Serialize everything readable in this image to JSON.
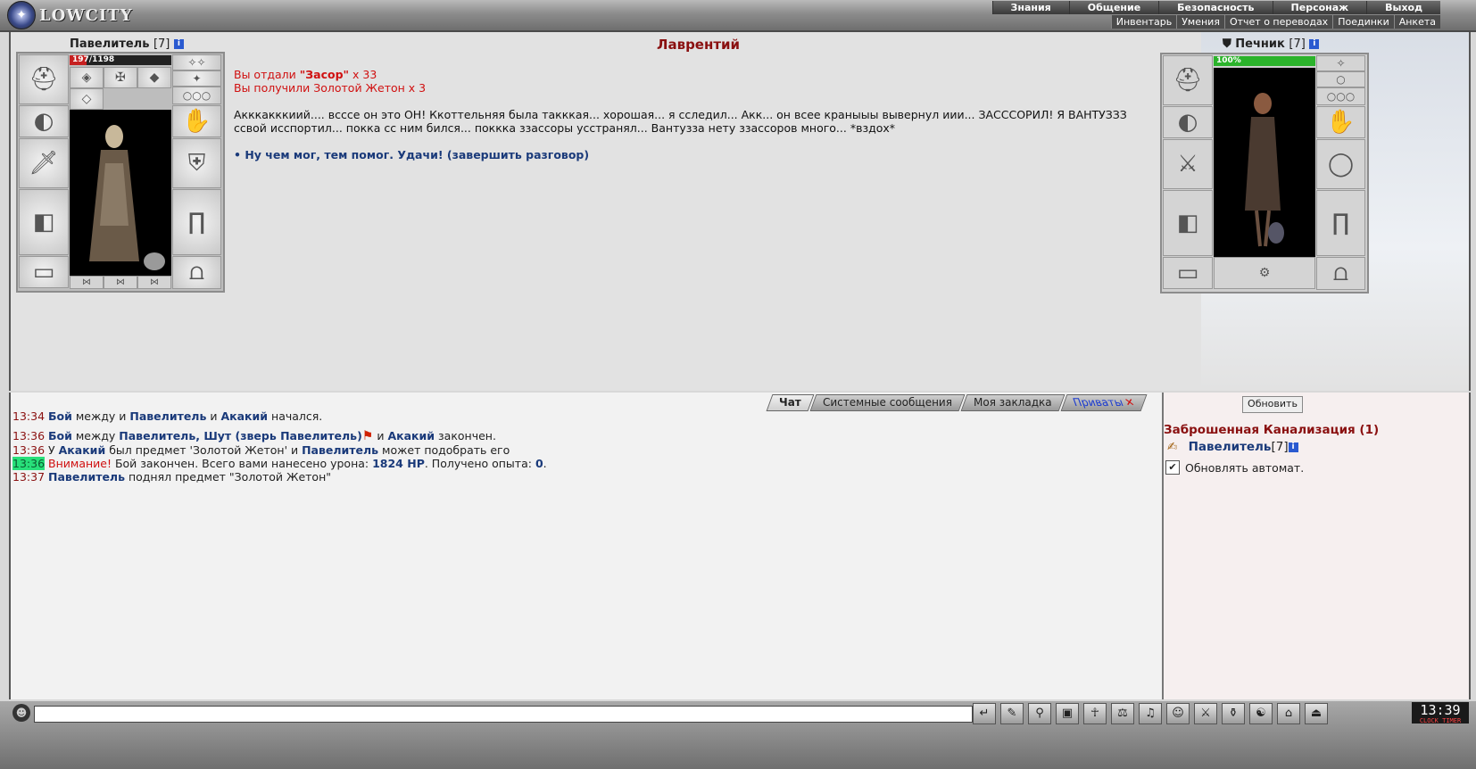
{
  "header": {
    "logo_text": "LOWCITY",
    "menu_top": [
      "Знания",
      "Общение",
      "Безопасность",
      "Персонаж",
      "Выход"
    ],
    "menu_sub": [
      "Инвентарь",
      "Умения",
      "Отчет о переводах",
      "Поединки",
      "Анкета"
    ]
  },
  "player": {
    "name": "Павелитель",
    "level": "[7]",
    "info": "i",
    "hp": "197",
    "hp_max": "/1198",
    "hp_fraction": 0.164
  },
  "npc": {
    "name": "Печник",
    "level": "[7]",
    "info": "i",
    "hp": "100%",
    "hp_fraction": 1.0
  },
  "dialog": {
    "title": "Лаврентий",
    "gave_prefix": "Вы отдали ",
    "gave_item": "\"Засор\"",
    "gave_suffix": " x 33",
    "received": "Вы получили Золотой Жетон x 3",
    "message": "Акккакккиий.... всссе он это ОН! Ккоттельняя была такккая... хорошая... я сследил... Акк... он всее краныыы вывернул иии... ЗАСССОРИЛ! Я ВАНТУЗЗЗ ссвой исспортил... покка сс ним бился... поккка ззассоры усстранял... Вантузза нету ззассоров много... *вздох*",
    "option": "• Ну чем мог, тем помог. Удачи! (завершить разговор)"
  },
  "chat": {
    "tabs": [
      "Чат",
      "Системные сообщения",
      "Моя закладка",
      "Приваты"
    ],
    "close": "✕",
    "lines": [
      {
        "time": "13:34",
        "parts": [
          [
            "b",
            "Бой"
          ],
          [
            "n",
            " между "
          ],
          [
            "n",
            "и "
          ],
          [
            "b",
            "Павелитель"
          ],
          [
            "n",
            " и "
          ],
          [
            "b",
            "Акакий"
          ],
          [
            "n",
            " начался."
          ]
        ]
      },
      {
        "time": "13:36",
        "parts": [
          [
            "b",
            "Бой"
          ],
          [
            "n",
            " между "
          ],
          [
            "b",
            "Павелитель, Шут (зверь Павелитель)"
          ],
          [
            "f",
            "⚑"
          ],
          [
            "n",
            " и "
          ],
          [
            "b",
            "Акакий"
          ],
          [
            "n",
            " закончен."
          ]
        ]
      },
      {
        "time": "13:36",
        "parts": [
          [
            "n",
            "У "
          ],
          [
            "b",
            "Акакий"
          ],
          [
            "n",
            " был предмет 'Золотой Жетон' и "
          ],
          [
            "b",
            "Павелитель"
          ],
          [
            "n",
            " может подобрать его"
          ]
        ]
      },
      {
        "time": "13:36",
        "hl": true,
        "parts": [
          [
            "w",
            "Внимание!"
          ],
          [
            "n",
            " Бой закончен. Всего вами нанесено урона: "
          ],
          [
            "b",
            "1824 HP"
          ],
          [
            "n",
            ". Получено опыта: "
          ],
          [
            "b",
            "0"
          ],
          [
            "n",
            "."
          ]
        ]
      },
      {
        "time": "13:37",
        "parts": [
          [
            "b",
            "Павелитель"
          ],
          [
            "n",
            " поднял предмет \"Золотой Жетон\""
          ]
        ]
      }
    ]
  },
  "side": {
    "refresh": "Обновить",
    "location": "Заброшенная Канализация (1)",
    "user": "Павелитель",
    "user_level": "[7]",
    "user_info": "i",
    "auto_label": "Обновлять автомат.",
    "auto_check": "✔"
  },
  "bottom": {
    "clock": "13:39",
    "clock_sub": "CLOCK TIMER",
    "icons": [
      "↵",
      "✎",
      "⚲",
      "▣",
      "☥",
      "⚖",
      "♫",
      "☺",
      "⚔",
      "⚱",
      "☯",
      "⌂",
      "⏏"
    ]
  },
  "colors": {
    "accent_red": "#8a1010",
    "link_blue": "#1a3a7a",
    "hp_red": "#c62020",
    "hp_green": "#2bb32b"
  }
}
